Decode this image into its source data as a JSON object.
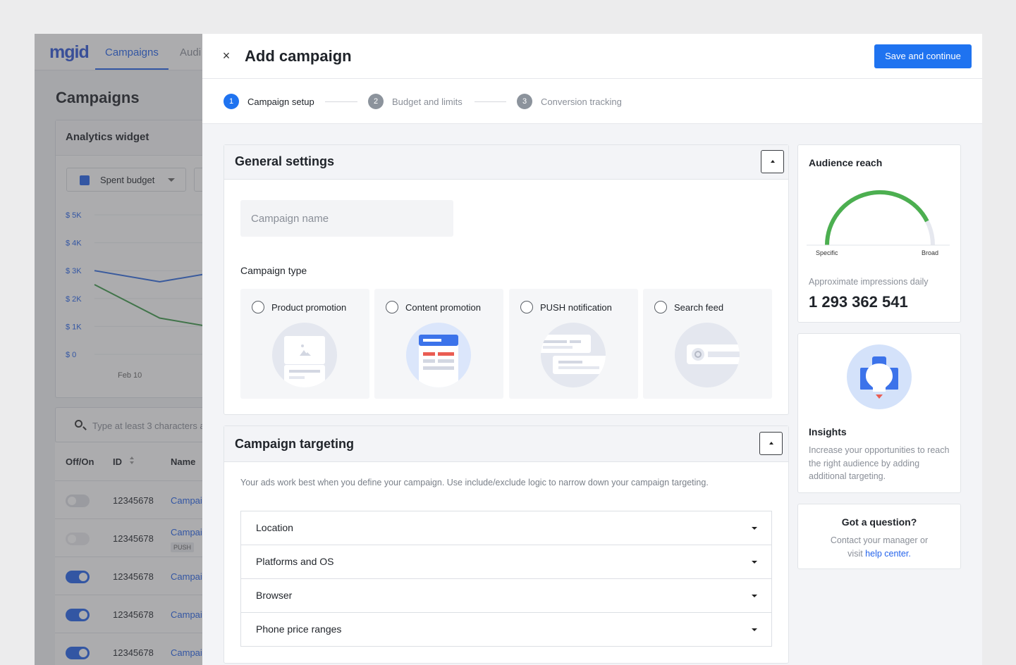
{
  "background_app": {
    "logo": "mgid",
    "nav_tabs": [
      {
        "label": "Campaigns",
        "active": true
      },
      {
        "label": "Audi",
        "active": false
      }
    ],
    "page_title": "Campaigns",
    "analytics_widget": {
      "title": "Analytics widget",
      "metric_select": "Spent budget",
      "metric_color": "#2463eb"
    },
    "chart_data": {
      "type": "line",
      "y_tick_labels": [
        "$ 5K",
        "$ 4K",
        "$ 3K",
        "$ 2K",
        "$ 1K",
        "$ 0"
      ],
      "x_tick_labels": [
        "Feb 10"
      ],
      "series": [
        {
          "color": "#2f6be0",
          "values": [
            3000,
            2600,
            3000
          ]
        },
        {
          "color": "#3d9a4a",
          "values": [
            2500,
            1300,
            900
          ]
        }
      ],
      "ylim": [
        0,
        5000
      ]
    },
    "search_placeholder": "Type at least 3 characters a",
    "table": {
      "columns": [
        "Off/On",
        "ID",
        "Name"
      ],
      "rows": [
        {
          "state": "off",
          "id": "12345678",
          "name": "Campai",
          "badge": ""
        },
        {
          "state": "disabled",
          "id": "12345678",
          "name": "Campai",
          "badge": "PUSH"
        },
        {
          "state": "on",
          "id": "12345678",
          "name": "Campai",
          "badge": ""
        },
        {
          "state": "on",
          "id": "12345678",
          "name": "Campai",
          "badge": ""
        },
        {
          "state": "on",
          "id": "12345678",
          "name": "Campai",
          "badge": ""
        }
      ]
    }
  },
  "modal": {
    "close_icon": "close-icon",
    "title": "Add campaign",
    "save_label": "Save and continue",
    "accent_color": "#1f73f0",
    "steps": [
      {
        "number": "1",
        "label": "Campaign setup",
        "active": true
      },
      {
        "number": "2",
        "label": "Budget and limits",
        "active": false
      },
      {
        "number": "3",
        "label": "Conversion tracking",
        "active": false
      }
    ],
    "general_settings": {
      "title": "General settings",
      "name_placeholder": "Campaign name",
      "type_label": "Campaign type",
      "types": [
        {
          "label": "Product promotion",
          "icon": "product-promotion-icon"
        },
        {
          "label": "Content promotion",
          "icon": "content-promotion-icon"
        },
        {
          "label": "PUSH notification",
          "icon": "push-notification-icon"
        },
        {
          "label": "Search feed",
          "icon": "search-feed-icon"
        }
      ]
    },
    "targeting": {
      "title": "Campaign targeting",
      "description": "Your ads work best when you define your campaign. Use include/exclude logic to narrow down your campaign targeting.",
      "sections": [
        "Location",
        "Platforms and OS",
        "Browser",
        "Phone price ranges"
      ]
    },
    "audience_reach": {
      "title": "Audience reach",
      "gauge_min_label": "Specific",
      "gauge_max_label": "Broad",
      "gauge_level": 0.85,
      "gauge_color": "#4caf50",
      "impressions_label": "Approximate impressions daily",
      "impressions_value": "1 293 362 541"
    },
    "insights": {
      "icon": "lightbulb-icon",
      "title": "Insights",
      "text": "Increase your opportunities to reach the right audience by adding additional targeting."
    },
    "question": {
      "title": "Got a question?",
      "text_line1": "Contact your manager or",
      "text_line2_prefix": "visit ",
      "link": "help center."
    }
  }
}
